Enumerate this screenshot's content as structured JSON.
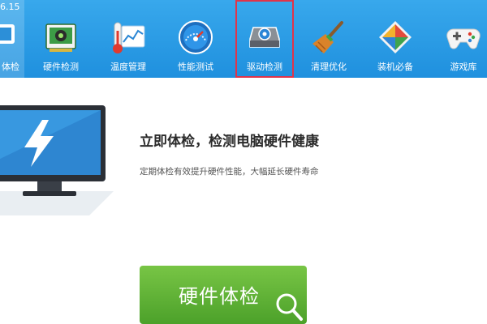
{
  "window": {
    "version": "6.15"
  },
  "toolbar": {
    "items": [
      {
        "label": "体检",
        "icon": "computer-check-icon"
      },
      {
        "label": "硬件检测",
        "icon": "hardware-card-icon"
      },
      {
        "label": "温度管理",
        "icon": "thermometer-icon"
      },
      {
        "label": "性能测试",
        "icon": "speedometer-icon"
      },
      {
        "label": "驱动检测",
        "icon": "driver-gear-icon"
      },
      {
        "label": "清理优化",
        "icon": "broom-icon"
      },
      {
        "label": "装机必备",
        "icon": "install-box-icon"
      },
      {
        "label": "游戏库",
        "icon": "gamepad-icon"
      }
    ],
    "highlight_color": "#e0344a",
    "background": "#2a9be6"
  },
  "hero": {
    "headline": "立即体检，检测电脑硬件健康",
    "subline": "定期体检有效提升硬件性能，大幅延长硬件寿命",
    "button_label": "硬件体检",
    "button_color": "#5fb234",
    "monitor_icon": "lightning-monitor-icon"
  }
}
